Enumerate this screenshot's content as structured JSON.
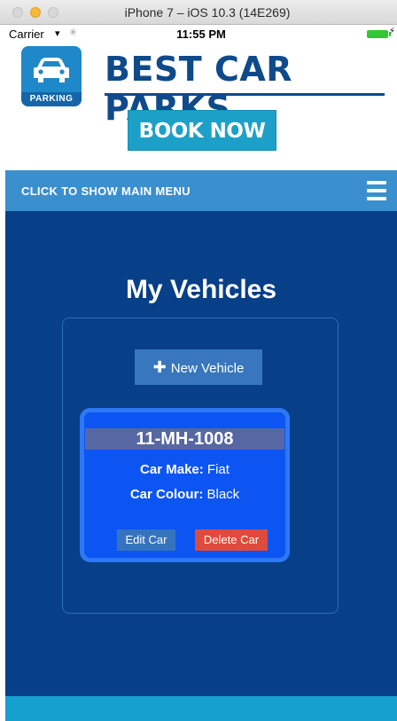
{
  "window": {
    "title": "iPhone 7 – iOS 10.3 (14E269)"
  },
  "status_bar": {
    "carrier": "Carrier",
    "time": "11:55 PM"
  },
  "header": {
    "logo_text": "PARKING",
    "brand": "BEST CAR PARKS",
    "book_label": "BOOK NOW"
  },
  "menu": {
    "label": "CLICK TO SHOW MAIN MENU"
  },
  "main": {
    "title": "My Vehicles",
    "new_vehicle_label": "New Vehicle",
    "vehicle": {
      "plate": "11-MH-1008",
      "make_label": "Car Make:",
      "make_value": "Fiat",
      "colour_label": "Car Colour:",
      "colour_value": "Black",
      "edit_label": "Edit Car",
      "delete_label": "Delete Car"
    }
  },
  "colors": {
    "brand_navy": "#0f4a8a",
    "book_teal": "#1da0c8",
    "menubar_blue": "#3a8fcf",
    "main_bg": "#073f88",
    "card_blue": "#0c55f2",
    "delete_red": "#e04a3a"
  }
}
